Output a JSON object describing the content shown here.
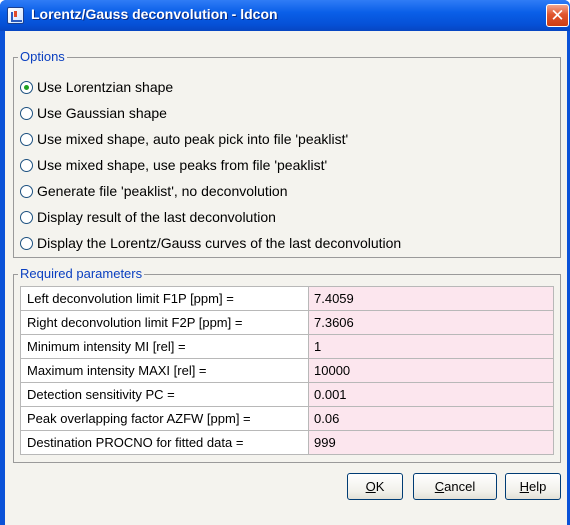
{
  "window": {
    "title": "Lorentz/Gauss deconvolution - ldcon",
    "close_glyph": "✕"
  },
  "options": {
    "legend": "Options",
    "selected_index": 0,
    "items": [
      {
        "label": "Use Lorentzian shape"
      },
      {
        "label": "Use Gaussian shape"
      },
      {
        "label": "Use mixed shape, auto peak pick into file 'peaklist'"
      },
      {
        "label": "Use mixed shape, use peaks from file 'peaklist'"
      },
      {
        "label": "Generate file 'peaklist', no deconvolution"
      },
      {
        "label": "Display result of the last deconvolution"
      },
      {
        "label": "Display the Lorentz/Gauss curves of the last deconvolution"
      }
    ]
  },
  "params": {
    "legend": "Required parameters",
    "rows": [
      {
        "label": "Left deconvolution limit F1P [ppm] =",
        "value": "7.4059"
      },
      {
        "label": "Right deconvolution limit F2P [ppm] =",
        "value": "7.3606"
      },
      {
        "label": "Minimum intensity MI [rel] =",
        "value": "1"
      },
      {
        "label": "Maximum intensity MAXI [rel] =",
        "value": "10000"
      },
      {
        "label": "Detection sensitivity PC =",
        "value": "0.001"
      },
      {
        "label": "Peak overlapping factor AZFW [ppm] =",
        "value": "0.06"
      },
      {
        "label": "Destination PROCNO for fitted data =",
        "value": "999"
      }
    ]
  },
  "buttons": {
    "ok": {
      "mnemonic": "O",
      "rest": "K"
    },
    "cancel": {
      "mnemonic": "C",
      "rest": "ancel"
    },
    "help": {
      "mnemonic": "H",
      "rest": "elp"
    }
  },
  "colors": {
    "title_bar": "#0a5fe8",
    "group_legend": "#0a3fc0",
    "input_background": "#fce6ee",
    "radio_selected": "#21a121"
  }
}
